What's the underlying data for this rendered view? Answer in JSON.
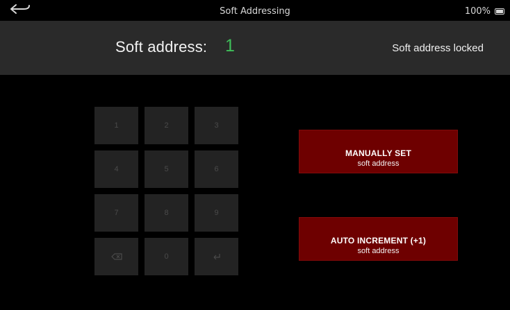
{
  "statusbar": {
    "title": "Soft Addressing",
    "battery": "100%",
    "back_icon": "back-arrow-icon",
    "battery_icon": "battery-icon"
  },
  "header": {
    "address_label": "Soft address:",
    "address_value": "1",
    "lock_status": "Soft address locked"
  },
  "keypad": {
    "keys": [
      "1",
      "2",
      "3",
      "4",
      "5",
      "6",
      "7",
      "8",
      "9",
      "⌫",
      "0",
      "⏎"
    ],
    "backspace_icon": "backspace-icon",
    "enter_icon": "enter-icon"
  },
  "actions": {
    "manual": {
      "label": "MANUALLY SET",
      "sublabel": "soft address"
    },
    "auto": {
      "label": "AUTO INCREMENT (+1)",
      "sublabel": "soft address"
    }
  },
  "colors": {
    "background": "#000000",
    "header_bg": "#2a2a2a",
    "address_value": "#3fbf5a",
    "button_bg": "#6e0000",
    "key_bg": "#232323"
  }
}
